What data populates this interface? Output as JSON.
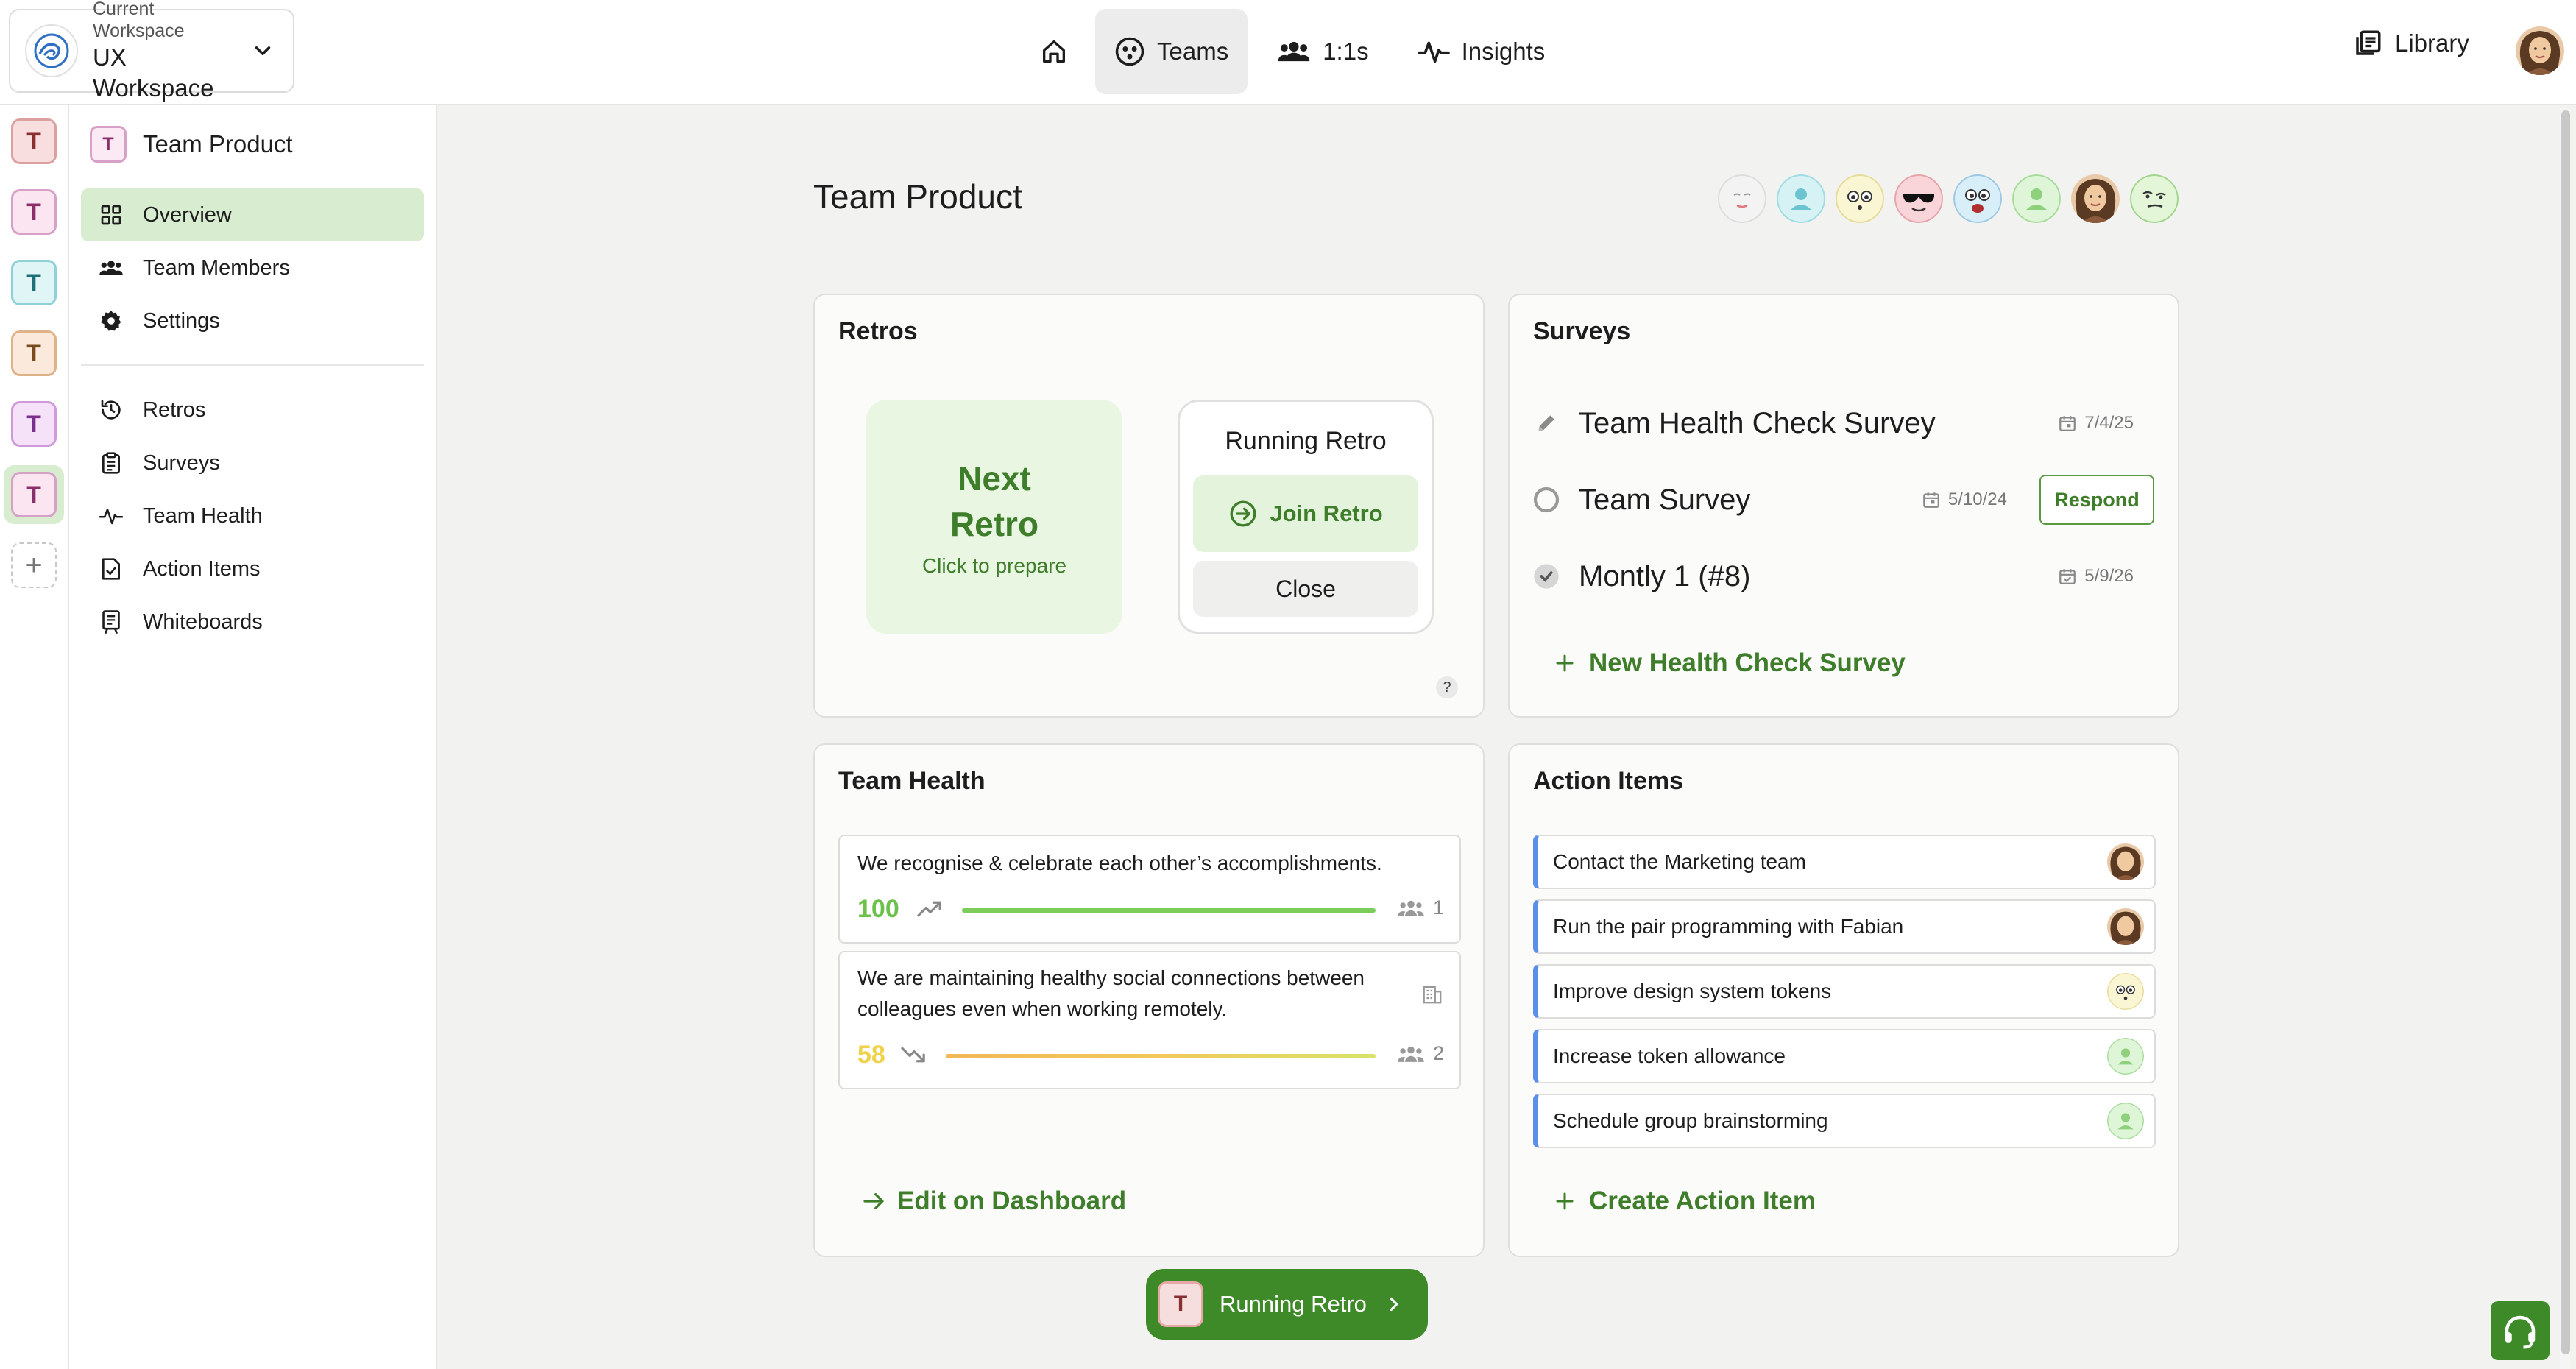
{
  "workspace": {
    "label": "Current Workspace",
    "name": "UX Workspace"
  },
  "nav": {
    "home_icon": "home-icon",
    "teams": "Teams",
    "one_on_ones": "1:1s",
    "insights": "Insights",
    "library": "Library"
  },
  "rail": {
    "letters": [
      "T",
      "T",
      "T",
      "T",
      "T",
      "T"
    ],
    "add": "+"
  },
  "sidebar": {
    "team_badge": "T",
    "team_name": "Team Product",
    "items": [
      {
        "label": "Overview",
        "icon": "grid-icon"
      },
      {
        "label": "Team Members",
        "icon": "people-icon"
      },
      {
        "label": "Settings",
        "icon": "gear-icon"
      },
      {
        "label": "Retros",
        "icon": "history-icon"
      },
      {
        "label": "Surveys",
        "icon": "clipboard-icon"
      },
      {
        "label": "Team Health",
        "icon": "pulse-icon"
      },
      {
        "label": "Action Items",
        "icon": "checklist-icon"
      },
      {
        "label": "Whiteboards",
        "icon": "whiteboard-icon"
      }
    ]
  },
  "page": {
    "title": "Team Product"
  },
  "retros": {
    "title": "Retros",
    "next_title": "Next Retro",
    "next_sub": "Click to prepare",
    "running_title": "Running Retro",
    "join": "Join Retro",
    "close": "Close",
    "help": "?"
  },
  "surveys": {
    "title": "Surveys",
    "rows": [
      {
        "name": "Team Health Check Survey",
        "date": "7/4/25"
      },
      {
        "name": "Team Survey",
        "date": "5/10/24",
        "action": "Respond"
      },
      {
        "name": "Montly 1 (#8)",
        "date": "5/9/26"
      }
    ],
    "new_label": "New Health Check Survey"
  },
  "team_health": {
    "title": "Team Health",
    "items": [
      {
        "text": "We recognise & celebrate each other’s accomplishments.",
        "score": "100",
        "count": "1",
        "score_value": 100
      },
      {
        "text": "We are maintaining healthy social connections between colleagues even when working remotely.",
        "score": "58",
        "count": "2",
        "score_value": 58
      }
    ],
    "edit_label": "Edit on Dashboard"
  },
  "action_items": {
    "title": "Action Items",
    "items": [
      "Contact the Marketing team",
      "Run the pair programming with Fabian",
      "Improve design system tokens",
      "Increase token allowance",
      "Schedule group brainstorming"
    ],
    "create_label": "Create Action Item"
  },
  "running_pill": {
    "badge": "T",
    "label": "Running Retro"
  },
  "colors": {
    "accent_green": "#3e7d2a",
    "active_bg": "#d8ecd0",
    "action_stripe": "#5b8fe8"
  }
}
